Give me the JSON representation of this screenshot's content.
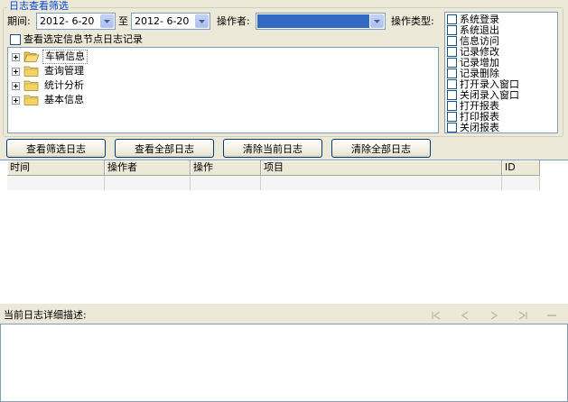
{
  "filter_group": {
    "title": "日志查看筛选",
    "period_label": "期间:",
    "start_date": "2012- 6-20",
    "to_label": "至",
    "end_date": "2012- 6-20",
    "operator_label": "操作者:",
    "operator_value": "",
    "op_type_label": "操作类型:",
    "view_selected_checkbox_label": "查看选定信息节点日志记录",
    "tree_items": [
      {
        "label": "车辆信息",
        "selected": true
      },
      {
        "label": "查询管理",
        "selected": false
      },
      {
        "label": "统计分析",
        "selected": false
      },
      {
        "label": "基本信息",
        "selected": false
      }
    ],
    "op_types": [
      "系统登录",
      "系统退出",
      "信息访问",
      "记录修改",
      "记录增加",
      "记录删除",
      "打开录入窗口",
      "关闭录入窗口",
      "打开报表",
      "打印报表",
      "关闭报表"
    ]
  },
  "buttons": {
    "view_filtered": "查看筛选日志",
    "view_all": "查看全部日志",
    "clear_current": "清除当前日志",
    "clear_all": "清除全部日志"
  },
  "log_table": {
    "columns": [
      "时间",
      "操作者",
      "操作",
      "项目",
      "ID"
    ]
  },
  "detail": {
    "label": "当前日志详细描述:"
  },
  "colors": {
    "title_blue": "#0046d5",
    "selection_blue": "#316ac5",
    "background": "#ece9d8"
  }
}
